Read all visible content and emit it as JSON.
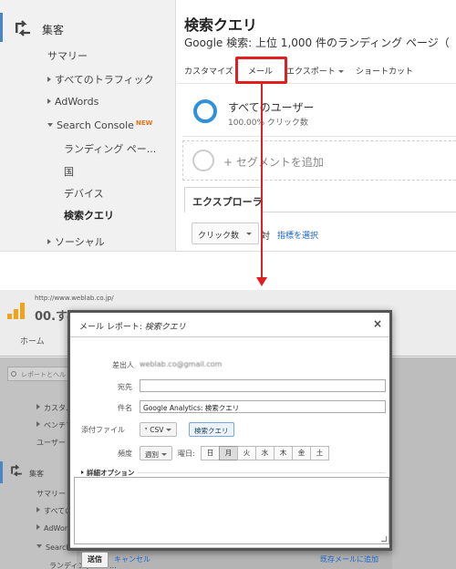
{
  "top": {
    "sidebar": {
      "category_label": "集客",
      "items": [
        {
          "label": "サマリー",
          "expand": ""
        },
        {
          "label": "すべてのトラフィック",
          "expand": "right"
        },
        {
          "label": "AdWords",
          "expand": "right"
        },
        {
          "label": "Search Console",
          "expand": "down",
          "badge": "NEW"
        },
        {
          "label": "ランディング ペー...",
          "expand": ""
        },
        {
          "label": "国",
          "expand": ""
        },
        {
          "label": "デバイス",
          "expand": ""
        },
        {
          "label": "検索クエリ",
          "expand": "",
          "active": true
        },
        {
          "label": "ソーシャル",
          "expand": "right"
        }
      ]
    },
    "main": {
      "title": "検索クエリ",
      "subtitle": "Google 検索: 上位 1,000 件のランディング ページ（",
      "toolbar": {
        "customize": "カスタマイズ",
        "email": "メール",
        "export": "エクスポート",
        "shortcut": "ショートカット"
      },
      "segment": {
        "name": "すべてのユーザー",
        "percent": "100.00% クリック数"
      },
      "add_segment": "+ セグメントを追加",
      "explorer_tab": "エクスプローラ",
      "metric_select": "クリック数",
      "vs": "対",
      "select_metric_link": "指標を選択"
    },
    "highlight_color": "#e02020"
  },
  "bottom": {
    "url": "http://www.weblab.co.jp/",
    "title_fragment": "00.すべ",
    "home_tab": "ホーム",
    "search_placeholder": "レポートとヘル",
    "sidebar": {
      "items": [
        "カスタム",
        "ベンチマ",
        "ユーザー"
      ],
      "category_label": "集客",
      "sub_items": [
        "サマリー",
        "すべての",
        "AdWords",
        "Search",
        "ランディング ペー..."
      ]
    },
    "dialog": {
      "title": "メール レポート: ",
      "title_report": "検索クエリ",
      "close": "×",
      "from_label": "差出人",
      "from_value": "weblab.co@gmail.com",
      "to_label": "宛先",
      "to_value": "",
      "subject_label": "件名",
      "subject_value": "Google Analytics: 検索クエリ",
      "attachment_label": "添付ファイル",
      "format_button": "CSV",
      "report_button": "検索クエリ",
      "frequency_label": "頻度",
      "frequency_value": "週別",
      "weekday_label": "曜日:",
      "days": [
        "日",
        "月",
        "火",
        "水",
        "木",
        "金",
        "土"
      ],
      "selected_day": "月",
      "advanced_label": "詳細オプション",
      "send_button": "送信",
      "cancel_link": "キャンセル",
      "add_existing_link": "既存メールに追加"
    }
  },
  "accent_color": "#4a86c5",
  "link_color": "#1a64c8"
}
